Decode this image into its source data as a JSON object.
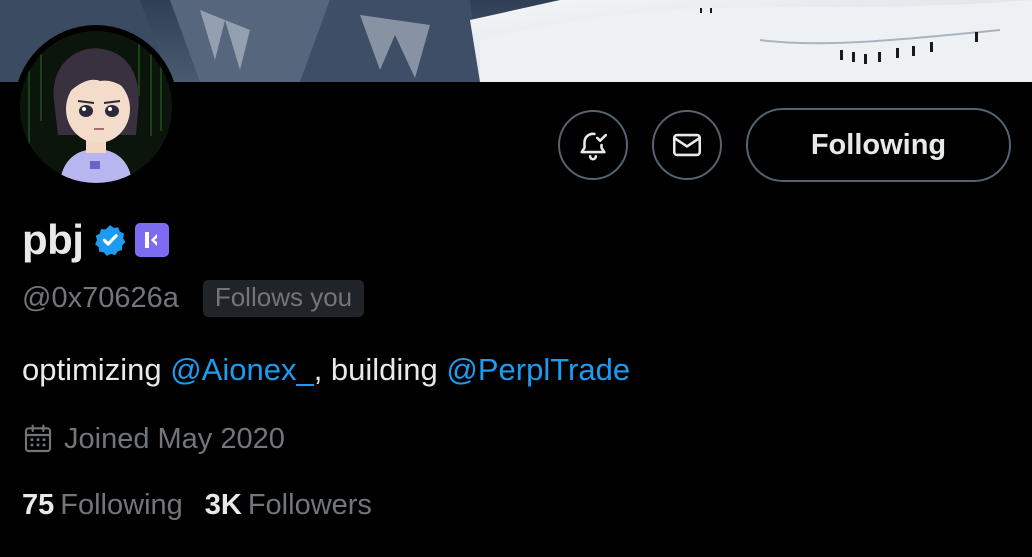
{
  "banner": {
    "alt_icon": "mountain-banner-image"
  },
  "profile": {
    "avatar_icon": "anime-avatar",
    "display_name": "pbj",
    "verified_icon": "verified-badge-icon",
    "affiliate_icon": "affiliate-badge-icon",
    "handle": "@0x70626a",
    "follows_you": "Follows you",
    "bio": {
      "text_1": "optimizing ",
      "mention_1": "@Aionex_",
      "text_2": ", building ",
      "mention_2": "@PerplTrade"
    },
    "joined": "Joined May 2020",
    "following_count": "75",
    "following_label": "Following",
    "followers_count": "3K",
    "followers_label": "Followers"
  },
  "actions": {
    "notify_icon": "bell-check-icon",
    "message_icon": "envelope-icon",
    "follow_state": "Following"
  },
  "colors": {
    "background": "#000000",
    "text_primary": "#e7e9ea",
    "text_secondary": "#71767b",
    "link": "#1d9bf0",
    "verified": "#1d9bf0",
    "affiliate": "#7d6cf2",
    "border": "#536471"
  }
}
